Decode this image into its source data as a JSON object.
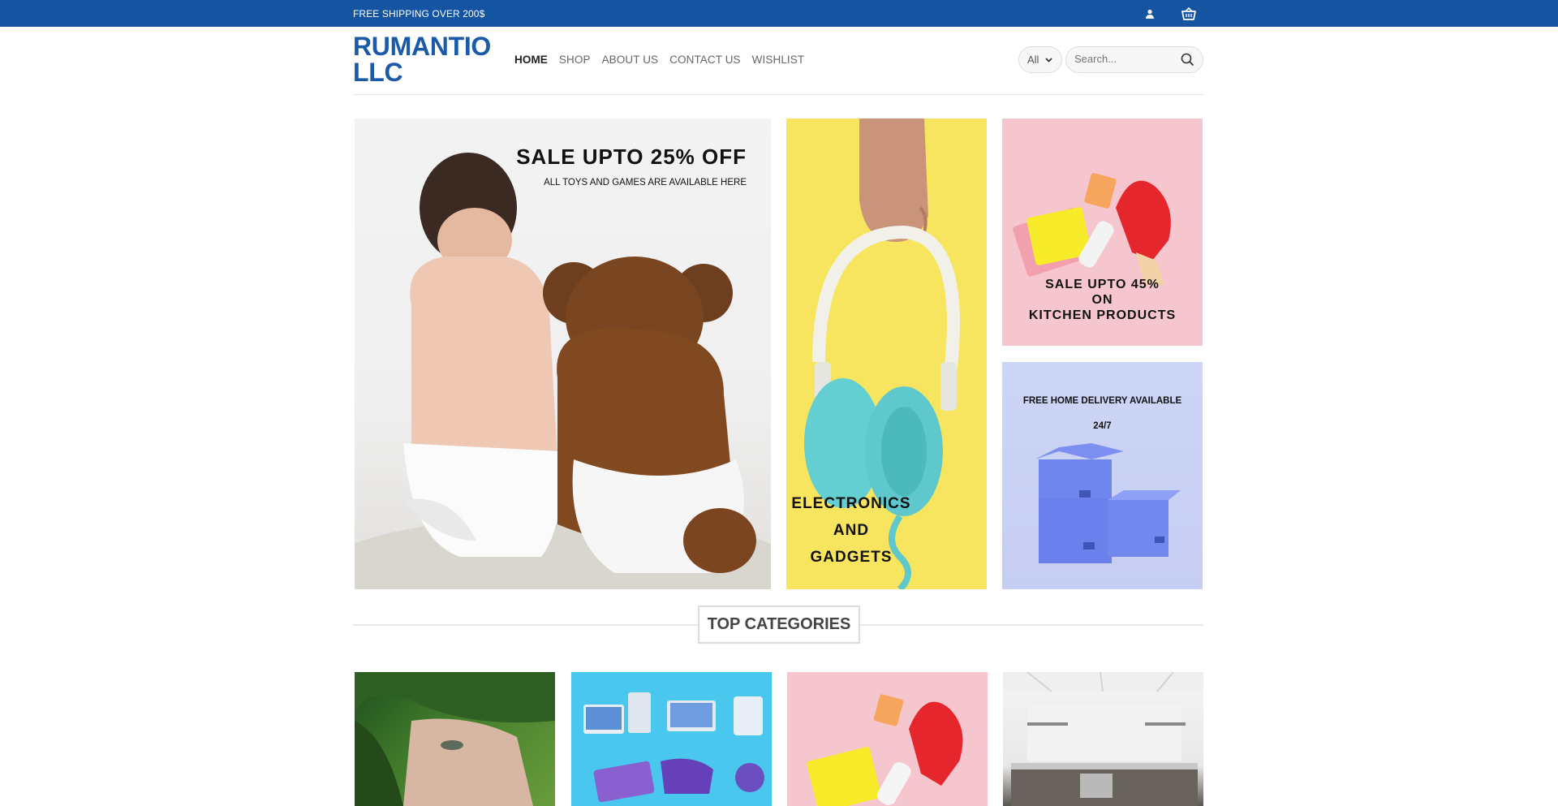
{
  "topbar": {
    "shipping_text": "FREE SHIPPING OVER 200$",
    "background": "#1454a0",
    "icons": [
      "user-icon",
      "basket-icon"
    ]
  },
  "header": {
    "logo_line1": "RUMANTIO",
    "logo_line2": "LLC",
    "logo_color": "#1a5aa8",
    "nav": [
      "HOME",
      "SHOP",
      "ABOUT US",
      "CONTACT US",
      "WISHLIST"
    ],
    "category_select": "All",
    "search_placeholder": "Search..."
  },
  "banners": {
    "toys": {
      "title": "SALE UPTO 25% OFF",
      "subtitle": "ALL TOYS AND GAMES ARE AVAILABLE HERE"
    },
    "electronics": {
      "line1": "ELECTRONICS",
      "line2": "AND",
      "line3": "GADGETS"
    },
    "kitchen": {
      "line1": "SALE UPTO 45%",
      "line2": "ON",
      "line3": "KITCHEN PRODUCTS"
    },
    "delivery": {
      "line1": "FREE HOME DELIVERY AVAILABLE",
      "line2": "24/7"
    }
  },
  "top_categories": {
    "heading": "TOP CATEGORIES"
  }
}
